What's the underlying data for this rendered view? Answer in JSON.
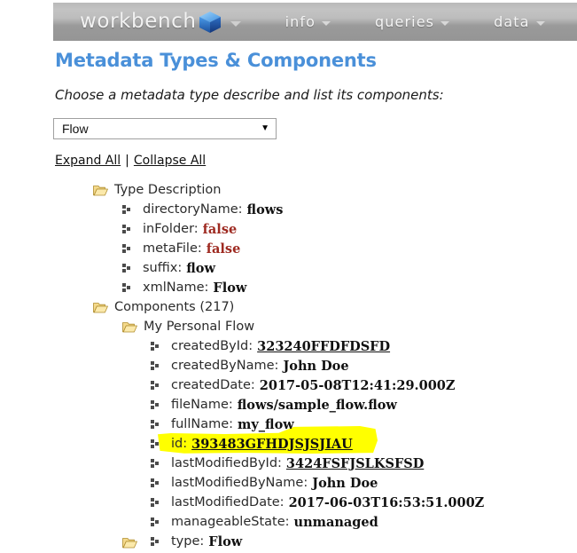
{
  "navbar": {
    "brand": "workbench",
    "brand_caret_icon": "chevron-down-icon",
    "logo_icon": "blue-cube-logo",
    "items": [
      {
        "label": "info",
        "caret_icon": "chevron-down-icon"
      },
      {
        "label": "queries",
        "caret_icon": "chevron-down-icon"
      },
      {
        "label": "data",
        "caret_icon": "chevron-down-icon"
      }
    ],
    "bar_color": "#a9a9a9",
    "text_color": "#f2f2f2"
  },
  "page": {
    "title": "Metadata Types & Components",
    "title_color": "#4a90d9",
    "subtitle": "Choose a metadata type describe and list its components:"
  },
  "type_select": {
    "name": "metadata-type-select",
    "value": "Flow",
    "arrow_icon": "chevron-down-icon"
  },
  "actions": {
    "expand_all": "Expand All",
    "separator": "|",
    "collapse_all": "Collapse All"
  },
  "tree": {
    "type_description": {
      "folder_label": "Type Description",
      "folder_icon": "open-folder-icon",
      "rows": [
        {
          "icon": "leaf-node-icon",
          "label": "directoryName:",
          "value": "flows",
          "style": "bold"
        },
        {
          "icon": "leaf-node-icon",
          "label": "inFolder:",
          "value": "false",
          "style": "bool"
        },
        {
          "icon": "leaf-node-icon",
          "label": "metaFile:",
          "value": "false",
          "style": "bool"
        },
        {
          "icon": "leaf-node-icon",
          "label": "suffix:",
          "value": "flow",
          "style": "bold"
        },
        {
          "icon": "leaf-node-icon",
          "label": "xmlName:",
          "value": "Flow",
          "style": "bold"
        }
      ]
    },
    "components": {
      "folder_label": "Components (217)",
      "folder_icon": "open-folder-icon",
      "count": 217,
      "component": {
        "folder_label": "My Personal Flow",
        "folder_icon": "open-folder-icon",
        "rows": [
          {
            "icon": "leaf-node-icon",
            "label": "createdById:",
            "value": "323240FFDFDSFD",
            "style": "link"
          },
          {
            "icon": "leaf-node-icon",
            "label": "createdByName:",
            "value": "John Doe",
            "style": "bold"
          },
          {
            "icon": "leaf-node-icon",
            "label": "createdDate:",
            "value": "2017-05-08T12:41:29.000Z",
            "style": "bold"
          },
          {
            "icon": "leaf-node-icon",
            "label": "fileName:",
            "value": "flows/sample_flow.flow",
            "style": "bold"
          },
          {
            "icon": "leaf-node-icon",
            "label": "fullName:",
            "value": "my_flow",
            "style": "bold"
          },
          {
            "icon": "leaf-node-icon",
            "label": "id:",
            "value": "393483GFHDJSJSJIAU",
            "style": "link",
            "highlighted": true
          },
          {
            "icon": "leaf-node-icon",
            "label": "lastModifiedById:",
            "value": "3424FSFJSLKSFSD",
            "style": "link"
          },
          {
            "icon": "leaf-node-icon",
            "label": "lastModifiedByName:",
            "value": "John Doe",
            "style": "bold"
          },
          {
            "icon": "leaf-node-icon",
            "label": "lastModifiedDate:",
            "value": "2017-06-03T16:53:51.000Z",
            "style": "bold"
          },
          {
            "icon": "leaf-node-icon",
            "label": "manageableState:",
            "value": "unmanaged",
            "style": "bold"
          },
          {
            "icon": "leaf-node-icon",
            "label": "type:",
            "value": "Flow",
            "style": "bold"
          }
        ]
      }
    }
  },
  "highlight_color": "#ffff00"
}
